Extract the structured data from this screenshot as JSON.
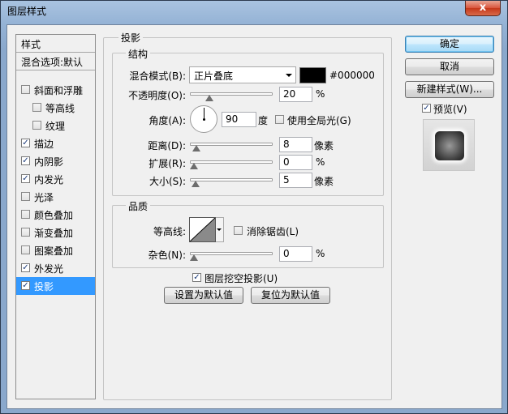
{
  "window": {
    "title": "图层样式",
    "close": "x"
  },
  "sidebar": {
    "header": "样式",
    "blend": "混合选项:默认",
    "items": [
      {
        "label": "斜面和浮雕",
        "checked": false
      },
      {
        "label": "等高线",
        "checked": false
      },
      {
        "label": "纹理",
        "checked": false
      },
      {
        "label": "描边",
        "checked": true
      },
      {
        "label": "内阴影",
        "checked": true
      },
      {
        "label": "内发光",
        "checked": true
      },
      {
        "label": "光泽",
        "checked": false
      },
      {
        "label": "颜色叠加",
        "checked": false
      },
      {
        "label": "渐变叠加",
        "checked": false
      },
      {
        "label": "图案叠加",
        "checked": false
      },
      {
        "label": "外发光",
        "checked": true
      },
      {
        "label": "投影",
        "checked": true
      }
    ]
  },
  "drop_shadow": {
    "title": "投影",
    "structure": {
      "title": "结构",
      "blend_mode_label": "混合模式(B):",
      "blend_mode_value": "正片叠底",
      "color_hex": "#000000",
      "opacity_label": "不透明度(O):",
      "opacity_value": "20",
      "opacity_unit": "%",
      "angle_label": "角度(A):",
      "angle_value": "90",
      "angle_unit": "度",
      "global_light_label": "使用全局光(G)",
      "distance_label": "距离(D):",
      "distance_value": "8",
      "distance_unit": "像素",
      "spread_label": "扩展(R):",
      "spread_value": "0",
      "spread_unit": "%",
      "size_label": "大小(S):",
      "size_value": "5",
      "size_unit": "像素"
    },
    "quality": {
      "title": "品质",
      "contour_label": "等高线:",
      "antialias_label": "消除锯齿(L)",
      "noise_label": "杂色(N):",
      "noise_value": "0",
      "noise_unit": "%"
    },
    "knockout_label": "图层挖空投影(U)",
    "make_default": "设置为默认值",
    "reset_default": "复位为默认值"
  },
  "buttons": {
    "ok": "确定",
    "cancel": "取消",
    "new_style": "新建样式(W)...",
    "preview_label": "预览(V)"
  },
  "check_mark": "✓"
}
